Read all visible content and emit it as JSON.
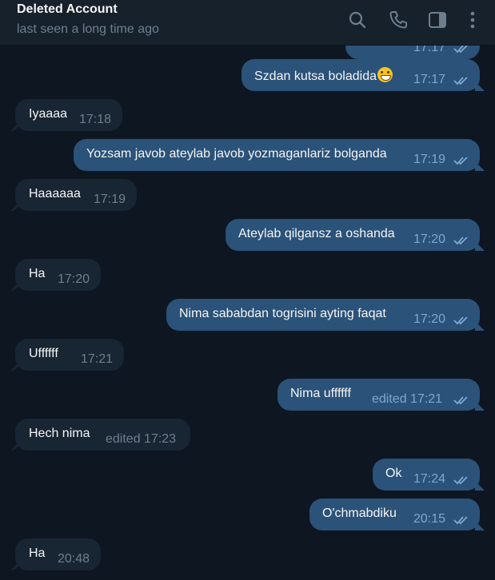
{
  "header": {
    "title": "Deleted Account",
    "status": "last seen a long time ago",
    "icons": [
      "search-icon",
      "phone-icon",
      "sidebar-toggle-icon",
      "more-icon"
    ]
  },
  "messages": [
    {
      "dir": "out",
      "text": "",
      "time": "17:17",
      "edited": false,
      "partial": true
    },
    {
      "dir": "out",
      "text": "Szdan kutsa boladida",
      "emoji": "grinning-face",
      "time": "17:17"
    },
    {
      "dir": "in",
      "text": "Iyaaaa",
      "time": "17:18"
    },
    {
      "dir": "out",
      "text": "Yozsam javob ateylab javob yozmaganlariz bolganda",
      "time": "17:19"
    },
    {
      "dir": "in",
      "text": "Haaaaaa",
      "time": "17:19"
    },
    {
      "dir": "out",
      "text": "Ateylab qilgansz a oshanda",
      "time": "17:20"
    },
    {
      "dir": "in",
      "text": "Ha",
      "time": "17:20"
    },
    {
      "dir": "out",
      "text": "Nima sababdan togrisini ayting faqat",
      "time": "17:20"
    },
    {
      "dir": "in",
      "text": "Uffffff",
      "time": "17:21"
    },
    {
      "dir": "out",
      "text": "Nima uffffff",
      "time": "edited 17:21"
    },
    {
      "dir": "in",
      "text": "Hech nima",
      "time": "edited 17:23"
    },
    {
      "dir": "out",
      "text": "Ok",
      "time": "17:24"
    },
    {
      "dir": "out",
      "text": "O'chmabdiku",
      "time": "20:15"
    },
    {
      "dir": "in",
      "text": "Ha",
      "time": "20:48"
    }
  ],
  "colors": {
    "background": "#0e1621",
    "header": "#17212b",
    "incoming_bubble": "#182533",
    "outgoing_bubble": "#2b5278",
    "read_ticks": "#7da8d3"
  }
}
